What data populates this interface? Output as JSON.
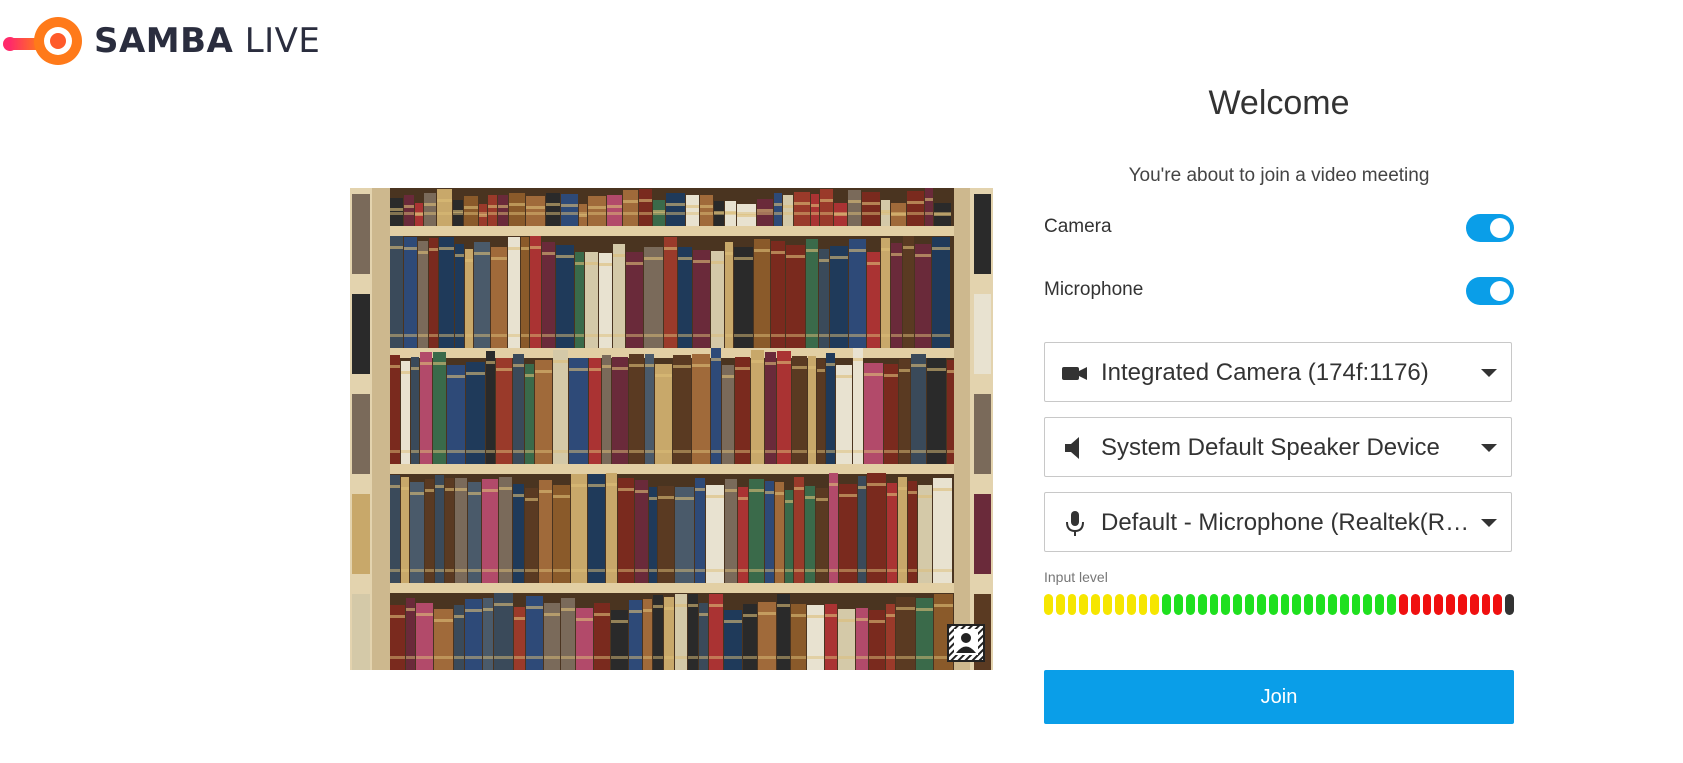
{
  "brand": {
    "name_bold": "SAMBA",
    "name_light": "LIVE",
    "accent": "#ff6b1a",
    "accent2": "#ff2a6a"
  },
  "welcome": {
    "title": "Welcome",
    "subtitle": "You're about to join a video meeting"
  },
  "toggles": {
    "camera": {
      "label": "Camera",
      "on": true
    },
    "microphone": {
      "label": "Microphone",
      "on": true
    }
  },
  "devices": {
    "camera": {
      "value": "Integrated Camera (174f:1176)",
      "icon": "video-camera-icon"
    },
    "speaker": {
      "value": "System Default Speaker Device",
      "icon": "speaker-icon"
    },
    "microphone": {
      "value": "Default - Microphone (Realtek(R) Audio)",
      "icon": "microphone-icon"
    }
  },
  "input_level": {
    "label": "Input level",
    "segments": 40,
    "active_fraction": 1.0,
    "colors": {
      "low": "#f6e600",
      "mid": "#1fe01f",
      "high": "#f01010",
      "peak": "#333333"
    }
  },
  "join": {
    "label": "Join"
  },
  "theme": {
    "primary": "#0a9ee8"
  }
}
